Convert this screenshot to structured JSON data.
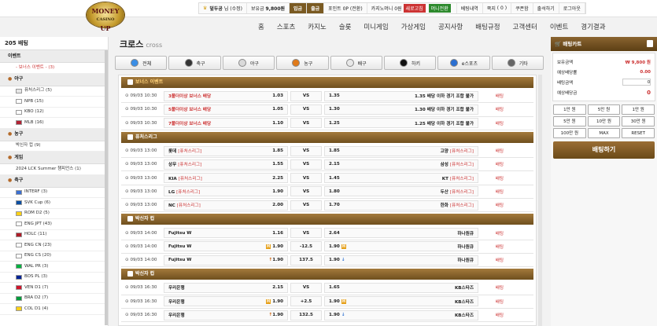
{
  "brand": {
    "logo": "MONEY UP",
    "logo_sub": "CASINO"
  },
  "userbar": {
    "grade_icon": "crown-icon",
    "nick": "덮두공",
    "level": "님 (수정)",
    "money_label": "보유금",
    "money": "9,800원",
    "deposit": "입금",
    "withdraw": "출금",
    "point_label": "포인트",
    "point": "0P (전환)",
    "cash": "카지노머니",
    "cash_val": "0원",
    "badge1": "새로고침",
    "badge2": "머니전환",
    "history": "베팅내역",
    "note": "쪽지",
    "note_count": "0",
    "coupon": "쿠폰함",
    "attend": "출석하기",
    "logout": "로그아웃"
  },
  "nav": [
    "홈",
    "스포츠",
    "카지노",
    "슬롯",
    "미니게임",
    "가상게임",
    "공지사항",
    "배팅규정",
    "고객센터",
    "이벤트",
    "경기결과"
  ],
  "sidebar": {
    "title": "205 배팅",
    "groups": [
      {
        "name": "이벤트",
        "icon": "",
        "items": [
          {
            "label": "- 보너스 이벤트 - (3)",
            "red": true
          }
        ]
      },
      {
        "name": "야구",
        "icon": "baseball-icon",
        "items": [
          {
            "label": "퓨처스리그 (5)",
            "flag": "#e6e6e6"
          },
          {
            "label": "NPB (15)",
            "flag": "#ffffff"
          },
          {
            "label": "KBO (12)",
            "flag": "#ffffff"
          },
          {
            "label": "MLB (16)",
            "flag": "#b22234"
          }
        ]
      },
      {
        "name": "농구",
        "icon": "basketball-icon",
        "items": [
          {
            "label": "박신자 컵 (9)",
            "flag": ""
          }
        ]
      },
      {
        "name": "게임",
        "icon": "esports-icon",
        "items": [
          {
            "label": "2024 LCK Summer 챔피언스 (1)",
            "flag": ""
          }
        ]
      },
      {
        "name": "축구",
        "icon": "soccer-icon",
        "items": [
          {
            "label": "INTERF (3)",
            "flag": "#3a6fd1"
          },
          {
            "label": "SVK Cup (6)",
            "flag": "#0b4ea2"
          },
          {
            "label": "ROM D2 (5)",
            "flag": "#fcd116"
          },
          {
            "label": "ENG JPT (43)",
            "flag": "#ffffff"
          },
          {
            "label": "HOLC (11)",
            "flag": "#ae1c28"
          },
          {
            "label": "ENG CN (23)",
            "flag": "#ffffff"
          },
          {
            "label": "ENG CS (20)",
            "flag": "#ffffff"
          },
          {
            "label": "WAL PR (3)",
            "flag": "#00b140"
          },
          {
            "label": "BOS PL (3)",
            "flag": "#002395"
          },
          {
            "label": "VEN D1 (7)",
            "flag": "#cf142b"
          },
          {
            "label": "BRA D2 (7)",
            "flag": "#009c3b"
          },
          {
            "label": "COL D1 (4)",
            "flag": "#fcd116"
          }
        ]
      }
    ]
  },
  "content": {
    "title": "크로스",
    "title_en": "cross",
    "sports": [
      {
        "label": "전체",
        "icon": "globe-icon",
        "color": "#3a8ee6"
      },
      {
        "label": "축구",
        "icon": "soccer-icon",
        "color": "#333333"
      },
      {
        "label": "야구",
        "icon": "baseball-icon",
        "color": "#d9d9d9"
      },
      {
        "label": "농구",
        "icon": "basketball-icon",
        "color": "#e07a1a"
      },
      {
        "label": "배구",
        "icon": "volleyball-icon",
        "color": "#e8e8e8"
      },
      {
        "label": "하키",
        "icon": "hockey-icon",
        "color": "#111111"
      },
      {
        "label": "e스포츠",
        "icon": "gamepad-icon",
        "color": "#2a6fd1"
      },
      {
        "label": "기타",
        "icon": "other-icon",
        "color": "#666666"
      }
    ],
    "groups": [
      {
        "name": "보너스 이벤트",
        "promo": true,
        "rows": [
          {
            "time": "⊙ 09/03 10:30",
            "home": "3폴더이상 보너스 배당",
            "home_red": true,
            "home_league": "",
            "hodd": "1.03",
            "hmark": "",
            "draw": "VS",
            "aodd": "1.35",
            "amark": "",
            "away": "1.35 배당 이하 경기 조합 불가",
            "away_league": "",
            "more": "배팅"
          },
          {
            "time": "⊙ 09/03 10:30",
            "home": "5폴더이상 보너스 배당",
            "home_red": true,
            "home_league": "",
            "hodd": "1.05",
            "hmark": "",
            "draw": "VS",
            "aodd": "1.30",
            "amark": "",
            "away": "1.30 배당 이하 경기 조합 불가",
            "away_league": "",
            "more": "배팅"
          },
          {
            "time": "⊙ 09/03 10:30",
            "home": "7폴더이상 보너스 배당",
            "home_red": true,
            "home_league": "",
            "hodd": "1.10",
            "hmark": "",
            "draw": "VS",
            "aodd": "1.25",
            "amark": "",
            "away": "1.25 배당 이하 경기 조합 불가",
            "away_league": "",
            "more": "배팅"
          }
        ]
      },
      {
        "name": "퓨처스리그",
        "promo": false,
        "rows": [
          {
            "time": "⊙ 09/03 13:00",
            "home": "롯데",
            "home_league": "[퓨처스리그]",
            "hodd": "1.85",
            "hmark": "",
            "draw": "VS",
            "aodd": "1.85",
            "amark": "",
            "away": "고양",
            "away_league": "[퓨처스리그]",
            "more": "배팅"
          },
          {
            "time": "⊙ 09/03 13:00",
            "home": "상무",
            "home_league": "[퓨처스리그]",
            "hodd": "1.55",
            "hmark": "",
            "draw": "VS",
            "aodd": "2.15",
            "amark": "",
            "away": "삼성",
            "away_league": "[퓨처스리그]",
            "more": "배팅"
          },
          {
            "time": "⊙ 09/03 13:00",
            "home": "KIA",
            "home_league": "[퓨처스리그]",
            "hodd": "2.25",
            "hmark": "",
            "draw": "VS",
            "aodd": "1.45",
            "amark": "",
            "away": "KT",
            "away_league": "[퓨처스리그]",
            "more": "배팅"
          },
          {
            "time": "⊙ 09/03 13:00",
            "home": "LG",
            "home_league": "[퓨처스리그]",
            "hodd": "1.90",
            "hmark": "",
            "draw": "VS",
            "aodd": "1.80",
            "amark": "",
            "away": "두산",
            "away_league": "[퓨처스리그]",
            "more": "배팅"
          },
          {
            "time": "⊙ 09/03 13:00",
            "home": "NC",
            "home_league": "[퓨처스리그]",
            "hodd": "2.00",
            "hmark": "",
            "draw": "VS",
            "aodd": "1.70",
            "amark": "",
            "away": "한화",
            "away_league": "[퓨처스리그]",
            "more": "배팅"
          }
        ]
      },
      {
        "name": "박신자 컵",
        "promo": false,
        "rows": [
          {
            "time": "⊙ 09/03 14:00",
            "home": "Fujitsu W",
            "home_league": "",
            "hodd": "1.16",
            "hmark": "",
            "draw": "VS",
            "aodd": "2.64",
            "amark": "",
            "away": "하나원큐",
            "away_league": "",
            "more": "배팅"
          },
          {
            "time": "⊙ 09/03 14:00",
            "home": "Fujitsu W",
            "home_league": "",
            "hodd": "1.90",
            "hmark": "H",
            "draw": "-12.5",
            "aodd": "1.90",
            "amark": "H",
            "away": "하나원큐",
            "away_league": "",
            "more": "배팅"
          },
          {
            "time": "⊙ 09/03 14:00",
            "home": "Fujitsu W",
            "home_league": "",
            "hodd": "1.90",
            "hmark": "↑",
            "draw": "137.5",
            "aodd": "1.90",
            "amark": "↓",
            "away": "하나원큐",
            "away_league": "",
            "more": "배팅"
          }
        ]
      },
      {
        "name": "박신자 컵",
        "promo": false,
        "rows": [
          {
            "time": "⊙ 09/03 16:30",
            "home": "우리은행",
            "home_league": "",
            "hodd": "2.15",
            "hmark": "",
            "draw": "VS",
            "aodd": "1.65",
            "amark": "",
            "away": "KB스타즈",
            "away_league": "",
            "more": "배팅"
          },
          {
            "time": "⊙ 09/03 16:30",
            "home": "우리은행",
            "home_league": "",
            "hodd": "1.90",
            "hmark": "H",
            "draw": "+2.5",
            "aodd": "1.90",
            "amark": "H",
            "away": "KB스타즈",
            "away_league": "",
            "more": "배팅"
          },
          {
            "time": "⊙ 09/03 16:30",
            "home": "우리은행",
            "home_league": "",
            "hodd": "1.90",
            "hmark": "↑",
            "draw": "132.5",
            "aodd": "1.90",
            "amark": "↓",
            "away": "KB스타즈",
            "away_league": "",
            "more": "배팅"
          }
        ]
      }
    ]
  },
  "slip": {
    "title": "배팅카트",
    "rows": [
      {
        "label": "보유금액",
        "value": "₩ 9,800 원"
      },
      {
        "label": "예상배당률",
        "value": "0.00"
      }
    ],
    "bet_label": "배팅금액",
    "bet_value": "0",
    "win_label": "예상배당금",
    "win_value": "0",
    "chips": [
      "1만 원",
      "5만 원",
      "1만 원",
      "5만 원",
      "10만 원",
      "30만 원",
      "100만 원",
      "MAX",
      "RESET"
    ],
    "bet_button": "배팅하기"
  }
}
